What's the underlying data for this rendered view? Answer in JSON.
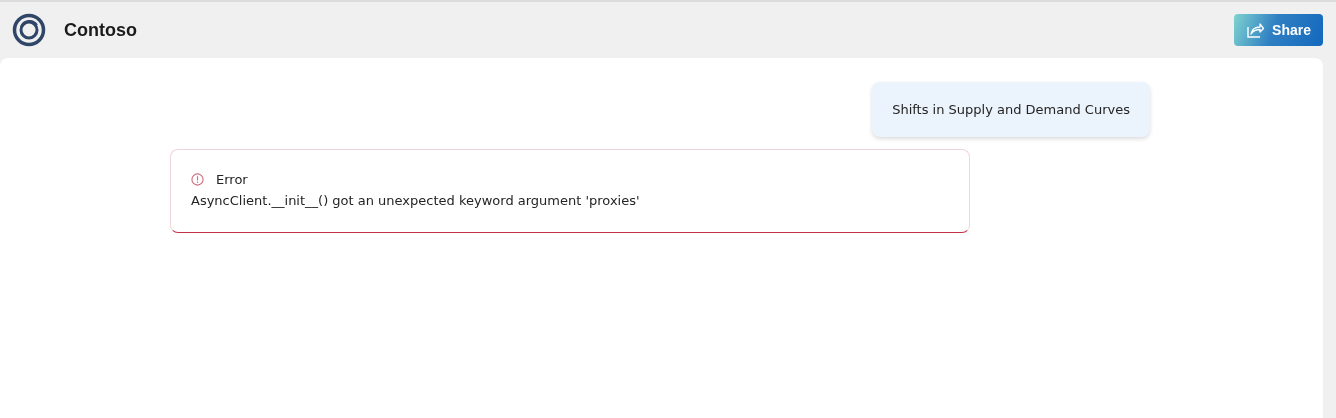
{
  "header": {
    "title": "Contoso",
    "share_button": "Share"
  },
  "messages": [
    {
      "kind": "user",
      "text": "Shifts in Supply and Demand Curves"
    },
    {
      "kind": "error",
      "title": "Error",
      "text": "AsyncClient.__init__() got an unexpected keyword argument 'proxies'"
    }
  ]
}
